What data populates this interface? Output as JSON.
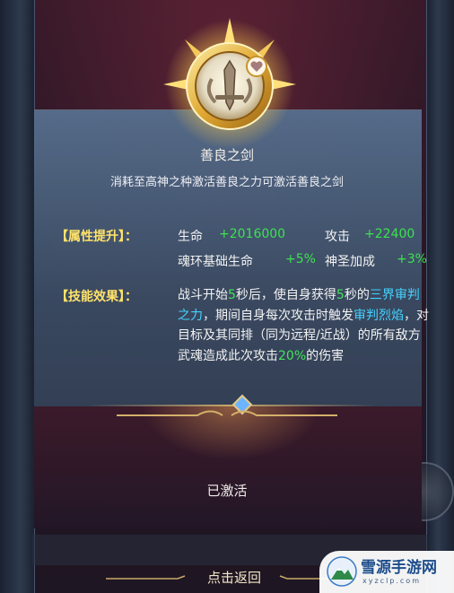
{
  "background": {
    "top_tab_label": "",
    "left_badge_label": "",
    "right_badge_label": ""
  },
  "emblem": {
    "icon": "sword-heart-emblem-icon"
  },
  "item": {
    "name": "善良之剑",
    "description": "消耗至高神之种激活善良之力可激活善良之剑"
  },
  "attributes": {
    "title": "【属性提升】：",
    "rows": [
      {
        "label": "生命",
        "value": "+2016000"
      },
      {
        "label": "攻击",
        "value": "+22400"
      },
      {
        "label": "魂环基础生命",
        "value": "+5%"
      },
      {
        "label": "神圣加成",
        "value": "+3%"
      }
    ]
  },
  "skill": {
    "title": "【技能效果】：",
    "t1": "战斗开始",
    "n1": "5",
    "t2": "秒后，使自身获得",
    "n2": "5",
    "t3": "秒的",
    "name1": "三界审判之力",
    "t4": "，期间自身每次攻击时触发",
    "name2": "审判烈焰",
    "t5": "，对目标及其同排（同为远程/近战）的所有敌方武魂造成此次攻击",
    "pct": "20%",
    "t6": "的伤害"
  },
  "status": {
    "activated": "已激活"
  },
  "footer": {
    "back_label": "点击返回"
  },
  "watermark": {
    "title": "雪源手游网",
    "url": "xyzclp.com"
  },
  "colors": {
    "highlight_green": "#44e35a",
    "highlight_cyan": "#45d2ff",
    "section_yellow": "#ffe36a",
    "gold": "#e6c887"
  }
}
